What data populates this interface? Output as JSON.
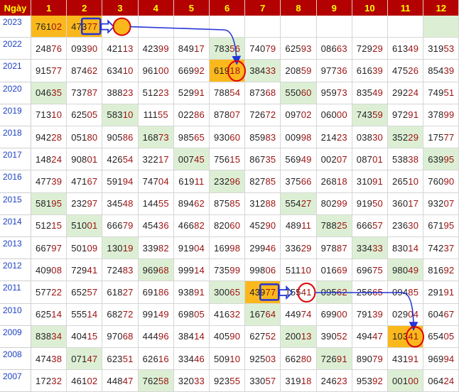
{
  "header": {
    "corner": "Ngày",
    "columns": [
      "1",
      "2",
      "3",
      "4",
      "5",
      "6",
      "7",
      "8",
      "9",
      "10",
      "11",
      "12"
    ]
  },
  "rows": [
    {
      "year": "2023",
      "cells": [
        "76102",
        "47377",
        "",
        "",
        "",
        "",
        "",
        "",
        "",
        "",
        "",
        ""
      ]
    },
    {
      "year": "2022",
      "cells": [
        "24876",
        "09390",
        "42113",
        "42399",
        "84917",
        "78356",
        "74079",
        "62593",
        "08663",
        "72929",
        "61349",
        "31953"
      ]
    },
    {
      "year": "2021",
      "cells": [
        "91577",
        "87462",
        "63410",
        "96100",
        "66992",
        "61918",
        "38433",
        "20859",
        "97736",
        "61639",
        "47526",
        "85439"
      ]
    },
    {
      "year": "2020",
      "cells": [
        "04635",
        "73787",
        "38823",
        "51223",
        "52991",
        "78854",
        "87368",
        "55060",
        "95973",
        "83549",
        "29224",
        "74951"
      ]
    },
    {
      "year": "2019",
      "cells": [
        "71310",
        "62505",
        "58310",
        "11155",
        "02286",
        "87807",
        "72672",
        "09702",
        "06000",
        "74359",
        "97291",
        "37899"
      ]
    },
    {
      "year": "2018",
      "cells": [
        "94228",
        "05180",
        "90586",
        "16873",
        "98565",
        "93060",
        "85983",
        "00998",
        "21423",
        "03830",
        "35229",
        "17577"
      ]
    },
    {
      "year": "2017",
      "cells": [
        "14824",
        "90801",
        "42654",
        "32217",
        "00745",
        "75615",
        "86735",
        "56949",
        "00207",
        "08701",
        "53838",
        "63995"
      ]
    },
    {
      "year": "2016",
      "cells": [
        "47739",
        "47167",
        "59194",
        "74704",
        "61911",
        "23296",
        "82785",
        "37566",
        "26818",
        "31091",
        "26510",
        "76090"
      ]
    },
    {
      "year": "2015",
      "cells": [
        "58195",
        "23297",
        "34548",
        "14455",
        "89462",
        "87585",
        "31288",
        "55427",
        "80299",
        "91950",
        "36017",
        "93207"
      ]
    },
    {
      "year": "2014",
      "cells": [
        "51215",
        "51001",
        "66679",
        "45436",
        "46682",
        "82060",
        "45290",
        "48911",
        "78825",
        "66657",
        "23630",
        "67195"
      ]
    },
    {
      "year": "2013",
      "cells": [
        "66797",
        "50109",
        "13019",
        "33982",
        "91904",
        "16998",
        "29946",
        "33629",
        "97887",
        "33433",
        "83014",
        "74237"
      ]
    },
    {
      "year": "2012",
      "cells": [
        "40908",
        "72941",
        "72483",
        "96968",
        "99914",
        "73599",
        "99806",
        "51110",
        "01669",
        "69675",
        "98049",
        "81692"
      ]
    },
    {
      "year": "2011",
      "cells": [
        "57722",
        "65257",
        "61827",
        "69186",
        "93891",
        "30065",
        "43977",
        "15541",
        "09562",
        "25665",
        "09485",
        "29191"
      ]
    },
    {
      "year": "2010",
      "cells": [
        "62514",
        "55514",
        "68272",
        "99149",
        "69805",
        "41632",
        "16764",
        "44974",
        "69900",
        "79139",
        "02904",
        "60467"
      ]
    },
    {
      "year": "2009",
      "cells": [
        "83834",
        "40415",
        "97068",
        "44496",
        "38414",
        "40590",
        "62752",
        "20013",
        "39052",
        "49447",
        "10341",
        "65405"
      ]
    },
    {
      "year": "2008",
      "cells": [
        "47438",
        "07147",
        "62351",
        "62616",
        "33446",
        "50910",
        "92503",
        "66280",
        "72691",
        "89079",
        "43191",
        "96994"
      ]
    },
    {
      "year": "2007",
      "cells": [
        "17232",
        "46102",
        "44847",
        "76258",
        "32033",
        "92355",
        "33057",
        "31918",
        "24623",
        "95392",
        "00100",
        "06424"
      ]
    }
  ],
  "highlights": {
    "green": [
      [
        0,
        11
      ],
      [
        1,
        5
      ],
      [
        2,
        6
      ],
      [
        3,
        0
      ],
      [
        3,
        7
      ],
      [
        4,
        2
      ],
      [
        4,
        9
      ],
      [
        5,
        3
      ],
      [
        5,
        10
      ],
      [
        6,
        4
      ],
      [
        6,
        11
      ],
      [
        7,
        5
      ],
      [
        8,
        0
      ],
      [
        8,
        7
      ],
      [
        9,
        1
      ],
      [
        9,
        8
      ],
      [
        10,
        2
      ],
      [
        10,
        9
      ],
      [
        11,
        3
      ],
      [
        11,
        10
      ],
      [
        12,
        5
      ],
      [
        12,
        8
      ],
      [
        13,
        6
      ],
      [
        14,
        0
      ],
      [
        14,
        7
      ],
      [
        15,
        1
      ],
      [
        15,
        8
      ],
      [
        16,
        3
      ],
      [
        16,
        10
      ]
    ],
    "orange": [
      [
        0,
        0
      ],
      [
        0,
        1
      ],
      [
        2,
        5
      ],
      [
        12,
        6
      ],
      [
        14,
        10
      ]
    ],
    "cell_bg": {
      "green": "#dcefd4",
      "orange": "#fbb81d"
    }
  },
  "annotations": {
    "box_color": "#2433d6",
    "circle_color": "#e00000",
    "arrow_color": "#2433d6"
  },
  "colors": {
    "header_bg": "#b30000",
    "header_text": "#ffff00",
    "year_text": "#1c3fc4",
    "digits_dark": "#222222",
    "digits_red": "#9e1010"
  }
}
